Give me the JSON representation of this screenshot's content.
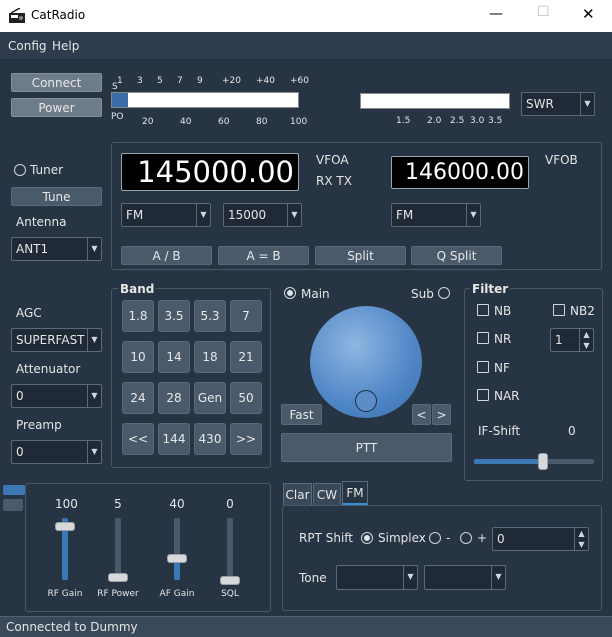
{
  "window": {
    "title": "CatRadio",
    "minimize": "—",
    "maximize": "☐",
    "close": "✕"
  },
  "menu": {
    "config": "Config",
    "help": "Help"
  },
  "controls": {
    "connect": "Connect",
    "power": "Power",
    "tuner_label": "Tuner",
    "tune": "Tune"
  },
  "antenna": {
    "label": "Antenna",
    "value": "ANT1"
  },
  "agc": {
    "label": "AGC",
    "value": "SUPERFAST"
  },
  "attenuator": {
    "label": "Attenuator",
    "value": "0"
  },
  "preamp": {
    "label": "Preamp",
    "value": "0"
  },
  "meter": {
    "s_label": "S",
    "s_ticks": [
      "1",
      "3",
      "5",
      "7",
      "9",
      "+20",
      "+40",
      "+60"
    ],
    "po_label": "PO",
    "po_ticks": [
      "20",
      "40",
      "60",
      "80",
      "100"
    ],
    "swr_ticks": [
      "1.5",
      "2.0",
      "2.5",
      "3.0",
      "3.5"
    ],
    "swr_select": "SWR"
  },
  "vfoa": {
    "freq": "145000.00",
    "label": "VFOA",
    "rxtx": "RX TX",
    "mode": "FM",
    "bandwidth": "15000"
  },
  "vfob": {
    "freq": "146000.00",
    "label": "VFOB",
    "mode": "FM"
  },
  "vfo_buttons": {
    "ab": "A / B",
    "aeqb": "A = B",
    "split": "Split",
    "qsplit": "Q Split"
  },
  "band": {
    "title": "Band",
    "buttons": [
      "1.8",
      "3.5",
      "5.3",
      "7",
      "10",
      "14",
      "18",
      "21",
      "24",
      "28",
      "Gen",
      "50",
      "<<",
      "144",
      "430",
      ">>"
    ]
  },
  "tuning": {
    "main": "Main",
    "sub": "Sub",
    "fast": "Fast",
    "left": "<",
    "right": ">",
    "ptt": "PTT"
  },
  "filter": {
    "title": "Filter",
    "nb": "NB",
    "nb2": "NB2",
    "nr": "NR",
    "nr_value": "1",
    "nf": "NF",
    "nar": "NAR",
    "ifshift_label": "IF-Shift",
    "ifshift_value": "0",
    "ifshift_level": 0.58
  },
  "gains": [
    {
      "name": "RF Gain",
      "value": "100",
      "level": 1.0
    },
    {
      "name": "RF Power",
      "value": "5",
      "level": 0.05
    },
    {
      "name": "AF Gain",
      "value": "40",
      "level": 0.4
    },
    {
      "name": "SQL",
      "value": "0",
      "level": 0.0
    }
  ],
  "tabs": {
    "clar": "Clar",
    "cw": "CW",
    "fm": "FM"
  },
  "fm": {
    "rpt_label": "RPT Shift",
    "simplex": "Simplex",
    "minus": "-",
    "plus": "+",
    "offset": "0",
    "tone_label": "Tone"
  },
  "status": {
    "text": "Connected to Dummy"
  }
}
